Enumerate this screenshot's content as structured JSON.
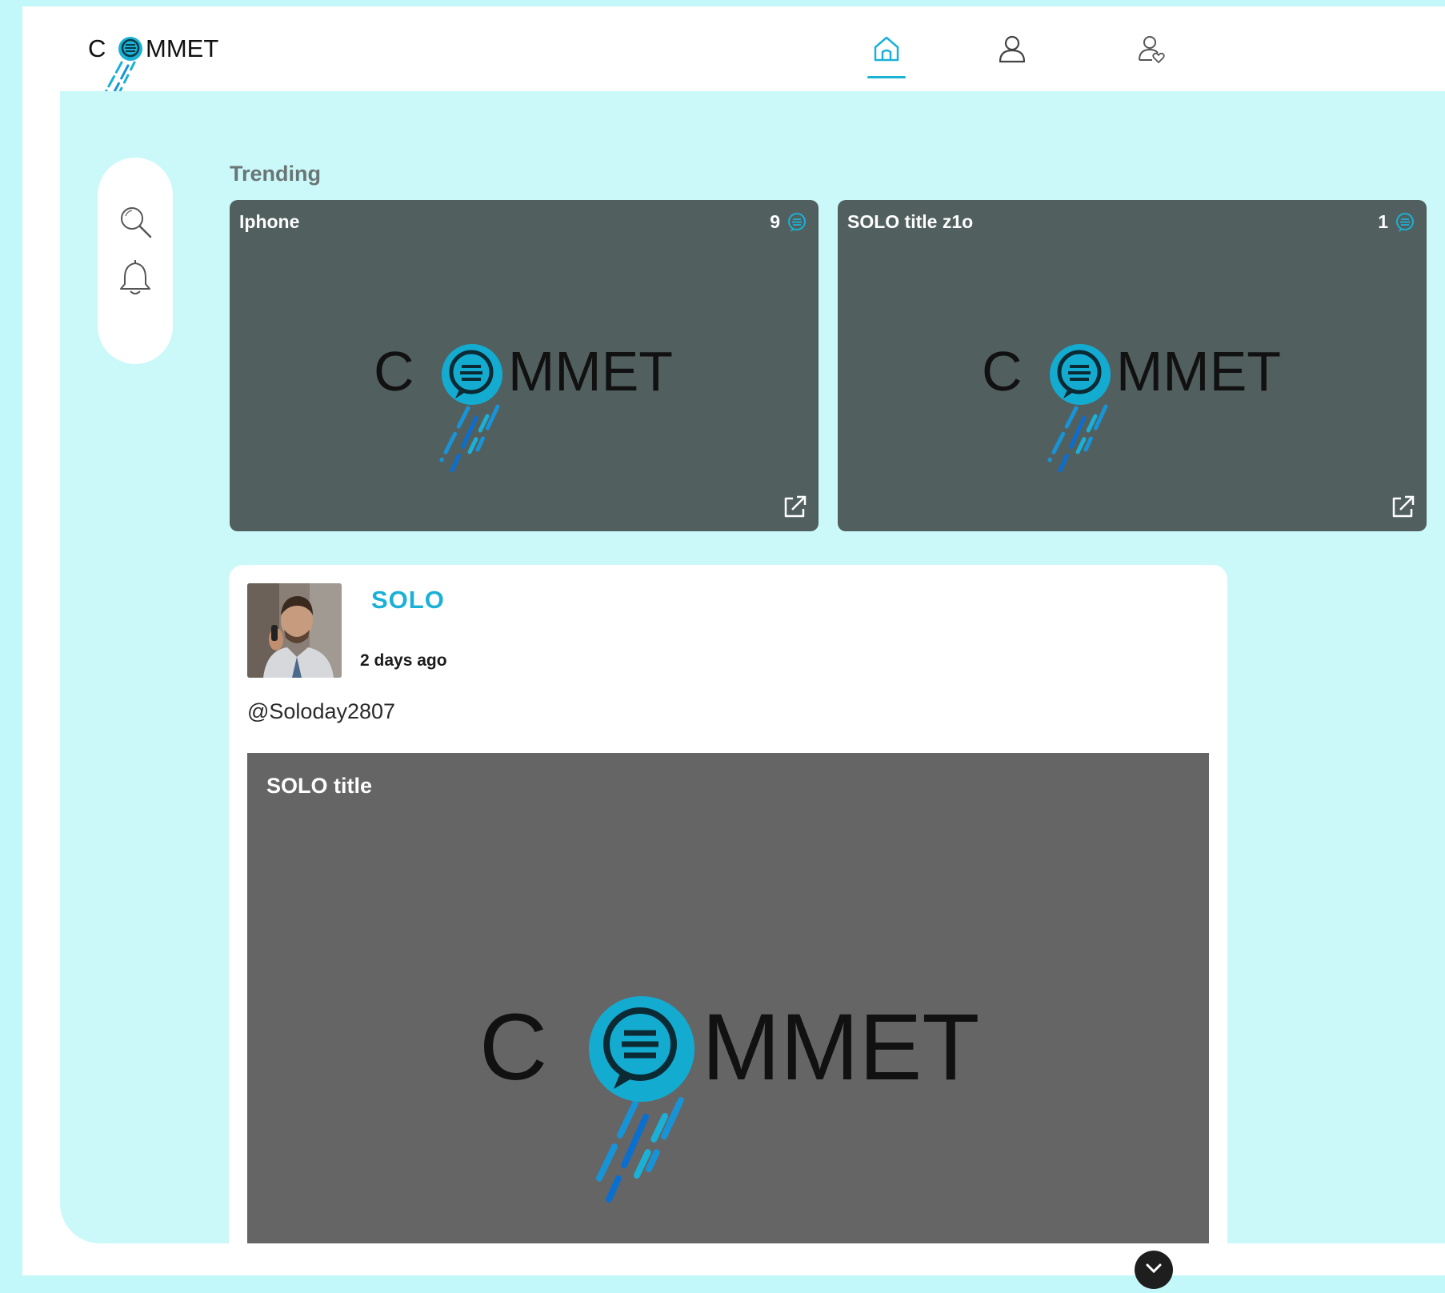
{
  "brand": {
    "letter_c": "C",
    "letters_rest": "MMET",
    "accent": "#1bb1d6",
    "accent_dark": "#0b6fd0"
  },
  "nav": {
    "items": [
      {
        "icon": "home-icon",
        "active": true
      },
      {
        "icon": "user-icon",
        "active": false
      },
      {
        "icon": "user-heart-icon",
        "active": false
      }
    ]
  },
  "sidebar": {
    "items": [
      {
        "icon": "search-icon"
      },
      {
        "icon": "bell-icon"
      }
    ]
  },
  "trending": {
    "label": "Trending",
    "cards": [
      {
        "title": "Iphone",
        "count": "9"
      },
      {
        "title": "SOLO title z1o",
        "count": "1"
      }
    ]
  },
  "post": {
    "author": "SOLO",
    "time": "2 days ago",
    "handle": "@Soloday2807",
    "media_title": "SOLO title"
  }
}
